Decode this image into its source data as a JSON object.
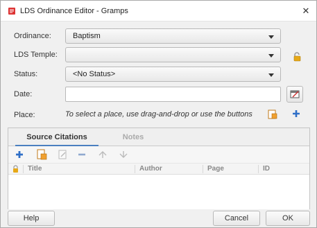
{
  "window": {
    "title": "LDS Ordinance Editor - Gramps",
    "close_glyph": "✕"
  },
  "form": {
    "ordinance": {
      "label": "Ordinance:",
      "value": "Baptism"
    },
    "temple": {
      "label": "LDS Temple:",
      "value": ""
    },
    "status": {
      "label": "Status:",
      "value": "<No Status>"
    },
    "date": {
      "label": "Date:",
      "value": ""
    },
    "place": {
      "label": "Place:",
      "hint": "To select a place, use drag-and-drop or use the buttons"
    }
  },
  "tabs": [
    {
      "label": "Source Citations",
      "active": true
    },
    {
      "label": "Notes",
      "active": false
    }
  ],
  "toolbar_icons": [
    "add-icon",
    "share-existing-icon",
    "edit-icon",
    "remove-icon",
    "move-up-icon",
    "move-down-icon"
  ],
  "columns": [
    "Title",
    "Author",
    "Page",
    "ID"
  ],
  "buttons": {
    "help": "Help",
    "cancel": "Cancel",
    "ok": "OK"
  },
  "colors": {
    "accent": "#4a7fc0",
    "add_icon": "#2f6fc7",
    "lock_icon": "#e6a817"
  }
}
